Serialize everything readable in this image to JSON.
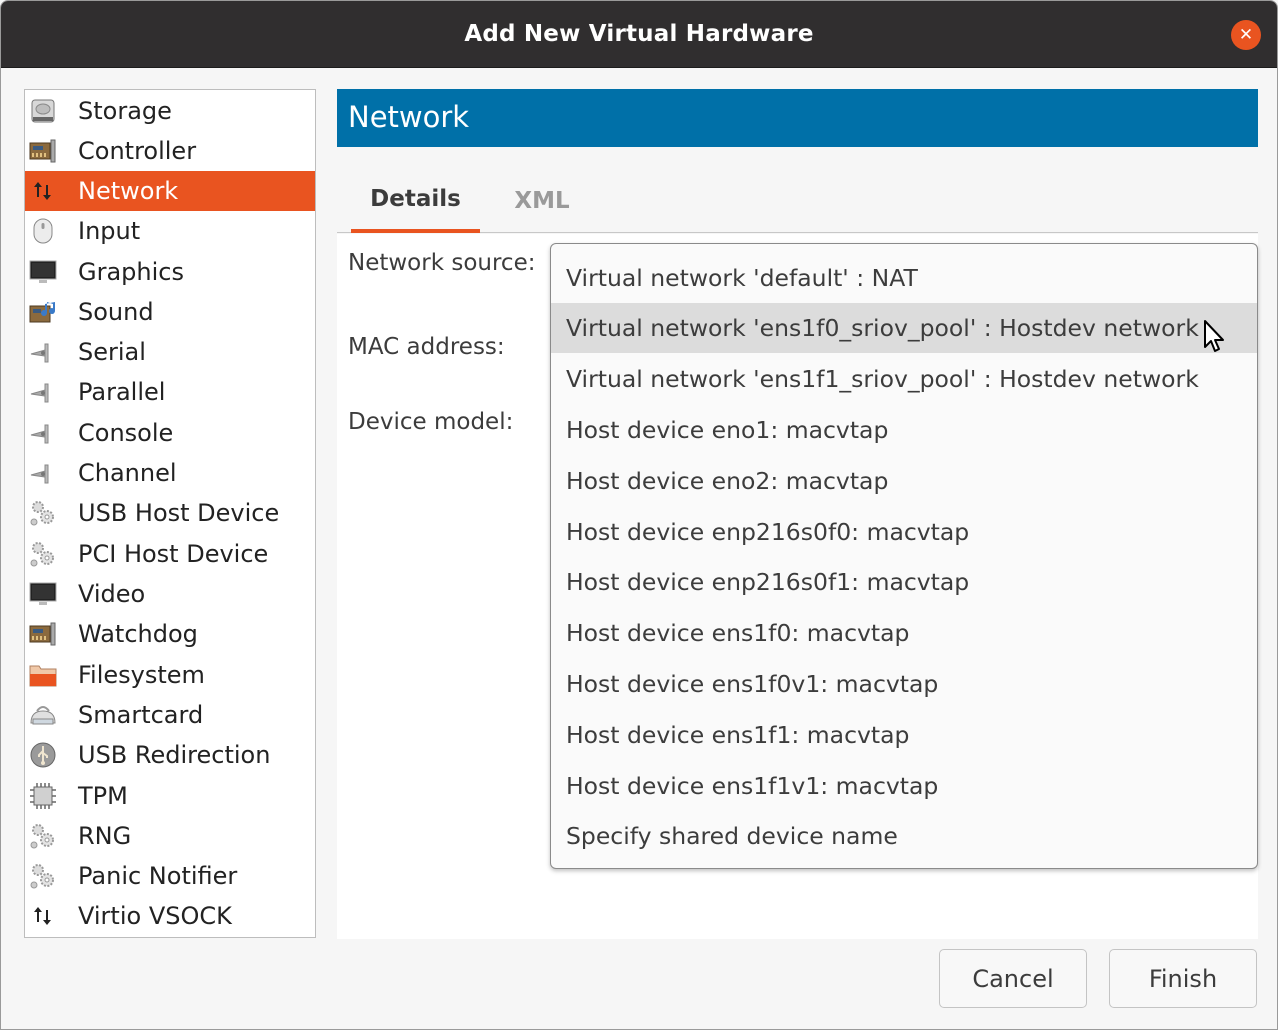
{
  "window": {
    "title": "Add New Virtual Hardware",
    "close_icon": "close-icon",
    "accent_color": "#e95420",
    "header_color": "#0070a8"
  },
  "sidebar": {
    "selected_index": 2,
    "items": [
      {
        "label": "Storage",
        "icon": "hard-disk-icon"
      },
      {
        "label": "Controller",
        "icon": "controller-card-icon"
      },
      {
        "label": "Network",
        "icon": "network-arrows-icon"
      },
      {
        "label": "Input",
        "icon": "mouse-icon"
      },
      {
        "label": "Graphics",
        "icon": "monitor-icon"
      },
      {
        "label": "Sound",
        "icon": "sound-card-icon"
      },
      {
        "label": "Serial",
        "icon": "serial-plug-icon"
      },
      {
        "label": "Parallel",
        "icon": "parallel-plug-icon"
      },
      {
        "label": "Console",
        "icon": "console-plug-icon"
      },
      {
        "label": "Channel",
        "icon": "channel-plug-icon"
      },
      {
        "label": "USB Host Device",
        "icon": "gears-icon"
      },
      {
        "label": "PCI Host Device",
        "icon": "gears-icon"
      },
      {
        "label": "Video",
        "icon": "monitor-icon"
      },
      {
        "label": "Watchdog",
        "icon": "controller-card-icon"
      },
      {
        "label": "Filesystem",
        "icon": "folder-icon"
      },
      {
        "label": "Smartcard",
        "icon": "smartcard-reader-icon"
      },
      {
        "label": "USB Redirection",
        "icon": "usb-icon"
      },
      {
        "label": "TPM",
        "icon": "chip-icon"
      },
      {
        "label": "RNG",
        "icon": "gears-icon"
      },
      {
        "label": "Panic Notifier",
        "icon": "gears-icon"
      },
      {
        "label": "Virtio VSOCK",
        "icon": "network-arrows-icon"
      }
    ]
  },
  "main": {
    "header_title": "Network",
    "tabs": [
      {
        "label": "Details",
        "active": true
      },
      {
        "label": "XML",
        "active": false
      }
    ],
    "form": {
      "network_source_label": "Network source:",
      "mac_address_label": "MAC address:",
      "device_model_label": "Device model:"
    },
    "network_source_dropdown": {
      "hover_index": 1,
      "options": [
        "Virtual network 'default' : NAT",
        "Virtual network 'ens1f0_sriov_pool' : Hostdev network",
        "Virtual network 'ens1f1_sriov_pool' : Hostdev network",
        "Host device eno1: macvtap",
        "Host device eno2: macvtap",
        "Host device enp216s0f0: macvtap",
        "Host device enp216s0f1: macvtap",
        "Host device ens1f0: macvtap",
        "Host device ens1f0v1: macvtap",
        "Host device ens1f1: macvtap",
        "Host device ens1f1v1: macvtap",
        "Specify shared device name"
      ]
    }
  },
  "footer": {
    "cancel_label": "Cancel",
    "finish_label": "Finish"
  }
}
